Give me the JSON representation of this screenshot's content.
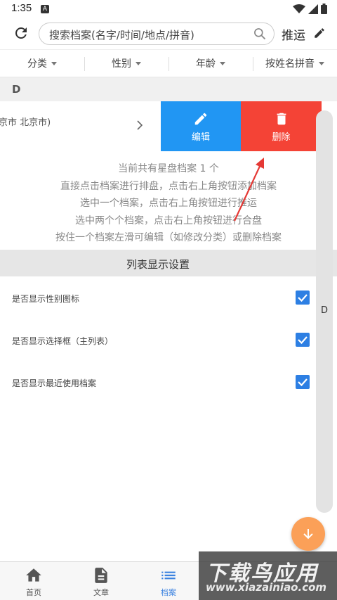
{
  "status_bar": {
    "time": "1:35",
    "notification_glyph": "A"
  },
  "search": {
    "placeholder": "搜索档案(名字/时间/地点/拼音)",
    "push_label": "推运"
  },
  "filters": [
    {
      "label": "分类"
    },
    {
      "label": "性别"
    },
    {
      "label": "年龄"
    },
    {
      "label": "按姓名拼音"
    }
  ],
  "section": {
    "letter": "D"
  },
  "record": {
    "location": "京市 北京市)"
  },
  "swipe_actions": {
    "edit_label": "编辑",
    "delete_label": "删除"
  },
  "info_lines": [
    "当前共有星盘档案 1 个",
    "直接点击档案进行排盘，点击右上角按钮添加档案",
    "选中一个档案，点击右上角按钮进行推运",
    "选中两个个档案，点击右上角按钮进行合盘",
    "按住一个档案左滑可编辑（如修改分类）或删除档案"
  ],
  "settings": {
    "title": "列表显示设置",
    "items": [
      {
        "label": "是否显示性别图标",
        "checked": true
      },
      {
        "label": "是否显示选择框（主列表）",
        "checked": true
      },
      {
        "label": "是否显示最近使用档案",
        "checked": true
      }
    ]
  },
  "scroller": {
    "letter": "D"
  },
  "bottom_nav": [
    {
      "label": "首页",
      "icon": "home-icon",
      "active": false
    },
    {
      "label": "文章",
      "icon": "document-icon",
      "active": false
    },
    {
      "label": "档案",
      "icon": "list-icon",
      "active": true
    }
  ],
  "watermark": {
    "title": "下载鸟应用",
    "url": "www.xiazainiao.com"
  },
  "colors": {
    "edit": "#2196f3",
    "delete": "#f44336",
    "accent": "#3b82e0",
    "fab": "#fba058",
    "checkbox": "#2d7fe3"
  }
}
